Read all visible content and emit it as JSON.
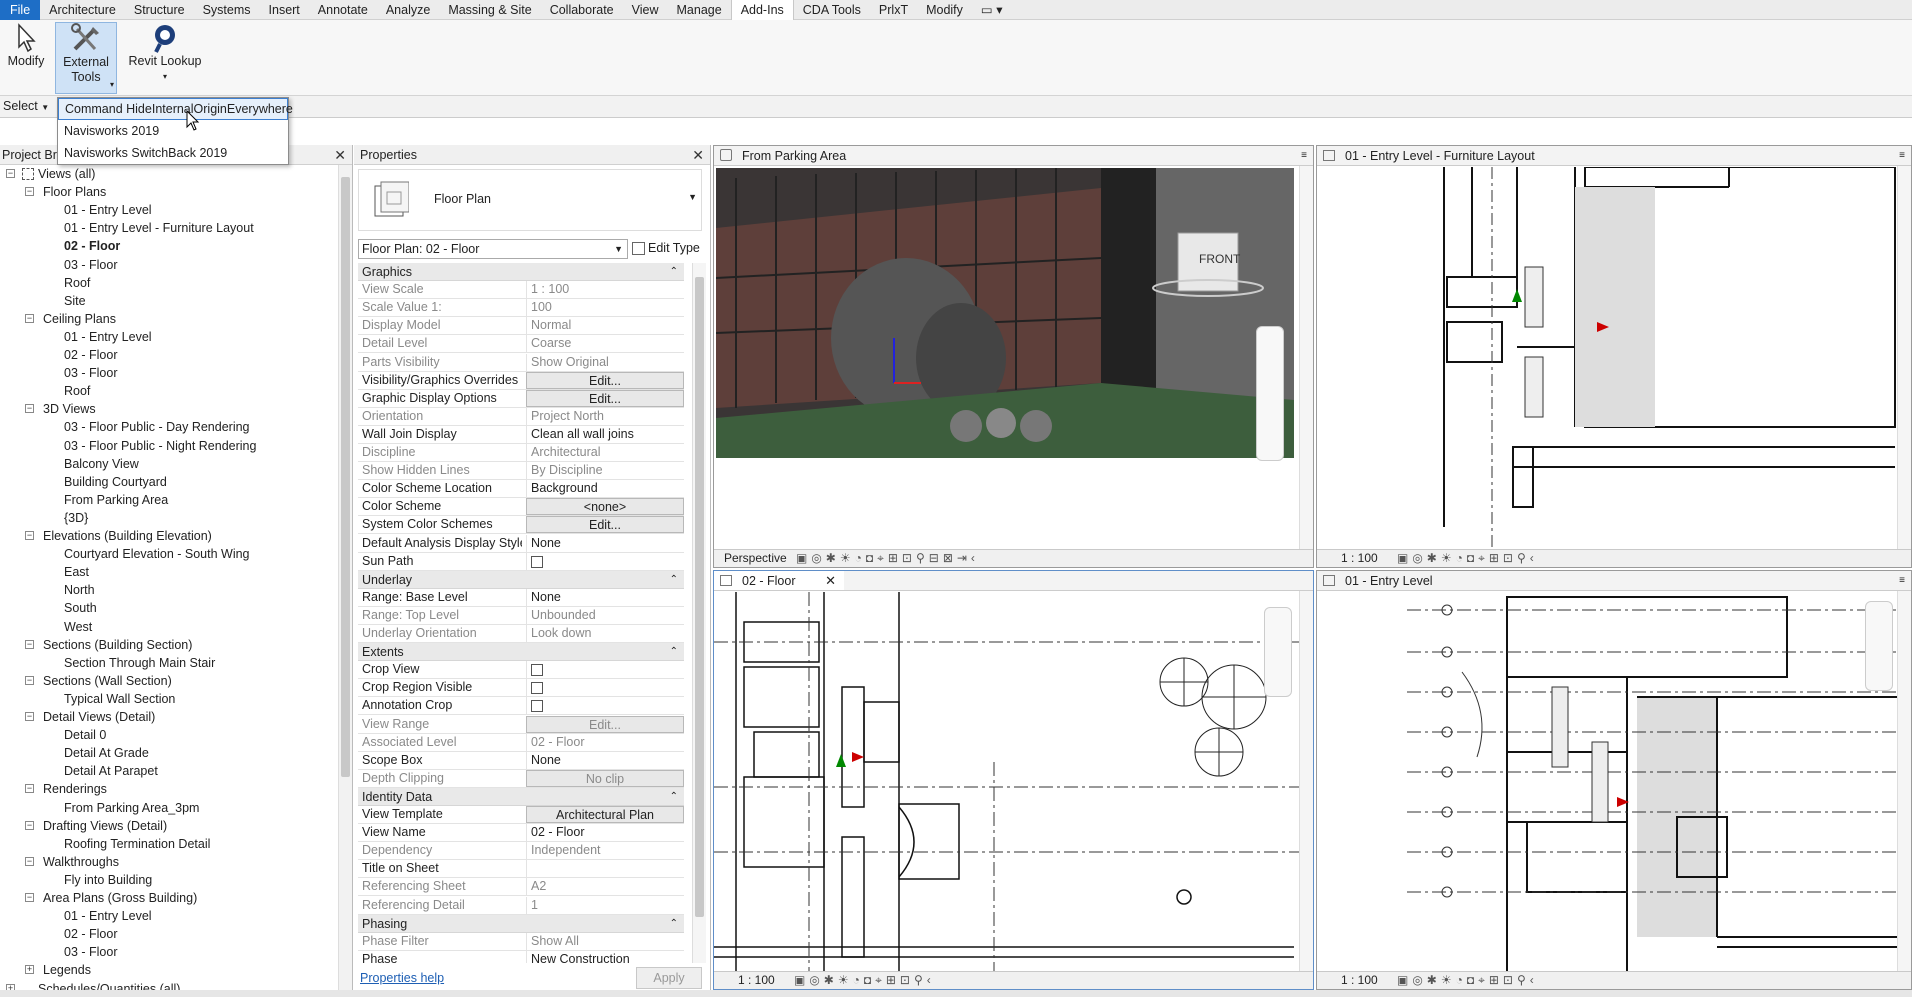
{
  "menu": {
    "items": [
      "File",
      "Architecture",
      "Structure",
      "Systems",
      "Insert",
      "Annotate",
      "Analyze",
      "Massing & Site",
      "Collaborate",
      "View",
      "Manage",
      "Add-Ins",
      "CDA Tools",
      "PrlxT",
      "Modify"
    ],
    "active": "Add-Ins"
  },
  "ribbon": {
    "modify_label": "Modify",
    "external_tools_label_1": "External",
    "external_tools_label_2": "Tools",
    "revit_lookup_label": "Revit Lookup",
    "select_label": "Select"
  },
  "dropdown": {
    "items": [
      "Command HideInternalOriginEverywhere",
      "Navisworks 2019",
      "Navisworks SwitchBack 2019"
    ]
  },
  "project_browser": {
    "title": "Project Bro",
    "tree": [
      {
        "label": "Views (all)",
        "level": 0,
        "toggle": "−"
      },
      {
        "label": "Floor Plans",
        "level": 1,
        "toggle": "−"
      },
      {
        "label": "01 - Entry Level",
        "level": 2
      },
      {
        "label": "01 - Entry Level - Furniture Layout",
        "level": 2
      },
      {
        "label": "02 - Floor",
        "level": 2,
        "bold": true
      },
      {
        "label": "03 - Floor",
        "level": 2
      },
      {
        "label": "Roof",
        "level": 2
      },
      {
        "label": "Site",
        "level": 2
      },
      {
        "label": "Ceiling Plans",
        "level": 1,
        "toggle": "−"
      },
      {
        "label": "01 - Entry Level",
        "level": 2
      },
      {
        "label": "02 - Floor",
        "level": 2
      },
      {
        "label": "03 - Floor",
        "level": 2
      },
      {
        "label": "Roof",
        "level": 2
      },
      {
        "label": "3D Views",
        "level": 1,
        "toggle": "−"
      },
      {
        "label": "03 - Floor Public - Day Rendering",
        "level": 2
      },
      {
        "label": "03 - Floor Public - Night Rendering",
        "level": 2
      },
      {
        "label": "Balcony View",
        "level": 2
      },
      {
        "label": "Building Courtyard",
        "level": 2
      },
      {
        "label": "From Parking Area",
        "level": 2
      },
      {
        "label": "{3D}",
        "level": 2
      },
      {
        "label": "Elevations (Building Elevation)",
        "level": 1,
        "toggle": "−"
      },
      {
        "label": "Courtyard Elevation - South Wing",
        "level": 2
      },
      {
        "label": "East",
        "level": 2
      },
      {
        "label": "North",
        "level": 2
      },
      {
        "label": "South",
        "level": 2
      },
      {
        "label": "West",
        "level": 2
      },
      {
        "label": "Sections (Building Section)",
        "level": 1,
        "toggle": "−"
      },
      {
        "label": "Section Through Main Stair",
        "level": 2
      },
      {
        "label": "Sections (Wall Section)",
        "level": 1,
        "toggle": "−"
      },
      {
        "label": "Typical Wall Section",
        "level": 2
      },
      {
        "label": "Detail Views (Detail)",
        "level": 1,
        "toggle": "−"
      },
      {
        "label": "Detail 0",
        "level": 2
      },
      {
        "label": "Detail At Grade",
        "level": 2
      },
      {
        "label": "Detail At Parapet",
        "level": 2
      },
      {
        "label": "Renderings",
        "level": 1,
        "toggle": "−"
      },
      {
        "label": "From Parking Area_3pm",
        "level": 2
      },
      {
        "label": "Drafting Views (Detail)",
        "level": 1,
        "toggle": "−"
      },
      {
        "label": "Roofing Termination Detail",
        "level": 2
      },
      {
        "label": "Walkthroughs",
        "level": 1,
        "toggle": "−"
      },
      {
        "label": "Fly into Building",
        "level": 2
      },
      {
        "label": "Area Plans (Gross Building)",
        "level": 1,
        "toggle": "−"
      },
      {
        "label": "01 - Entry Level",
        "level": 2
      },
      {
        "label": "02 - Floor",
        "level": 2
      },
      {
        "label": "03 - Floor",
        "level": 2
      },
      {
        "label": "Legends",
        "level": 1,
        "toggle": "+"
      },
      {
        "label": "Schedules/Quantities (all)",
        "level": 0,
        "toggle": "+"
      }
    ]
  },
  "properties": {
    "title": "Properties",
    "type_name": "Floor Plan",
    "selector": "Floor Plan: 02 - Floor",
    "edit_type": "Edit Type",
    "help": "Properties help",
    "apply": "Apply",
    "sections": [
      {
        "header": "Graphics",
        "rows": [
          {
            "k": "View Scale",
            "v": "1 : 100",
            "dim": true
          },
          {
            "k": "Scale Value    1:",
            "v": "100",
            "dim": true
          },
          {
            "k": "Display Model",
            "v": "Normal",
            "dim": true
          },
          {
            "k": "Detail Level",
            "v": "Coarse",
            "dim": true
          },
          {
            "k": "Parts Visibility",
            "v": "Show Original",
            "dim": true
          },
          {
            "k": "Visibility/Graphics Overrides",
            "v": "Edit...",
            "btn": true
          },
          {
            "k": "Graphic Display Options",
            "v": "Edit...",
            "btn": true
          },
          {
            "k": "Orientation",
            "v": "Project North",
            "dim": true
          },
          {
            "k": "Wall Join Display",
            "v": "Clean all wall joins"
          },
          {
            "k": "Discipline",
            "v": "Architectural",
            "dim": true
          },
          {
            "k": "Show Hidden Lines",
            "v": "By Discipline",
            "dim": true
          },
          {
            "k": "Color Scheme Location",
            "v": "Background"
          },
          {
            "k": "Color Scheme",
            "v": "<none>",
            "btn": true
          },
          {
            "k": "System Color Schemes",
            "v": "Edit...",
            "btn": true
          },
          {
            "k": "Default Analysis Display Style",
            "v": "None"
          },
          {
            "k": "Sun Path",
            "v": "",
            "check": true
          }
        ]
      },
      {
        "header": "Underlay",
        "rows": [
          {
            "k": "Range: Base Level",
            "v": "None"
          },
          {
            "k": "Range: Top Level",
            "v": "Unbounded",
            "dim": true
          },
          {
            "k": "Underlay Orientation",
            "v": "Look down",
            "dim": true
          }
        ]
      },
      {
        "header": "Extents",
        "rows": [
          {
            "k": "Crop View",
            "v": "",
            "check": true
          },
          {
            "k": "Crop Region Visible",
            "v": "",
            "check": true
          },
          {
            "k": "Annotation Crop",
            "v": "",
            "check": true
          },
          {
            "k": "View Range",
            "v": "Edit...",
            "btn": true,
            "dim": true
          },
          {
            "k": "Associated Level",
            "v": "02 - Floor",
            "dim": true
          },
          {
            "k": "Scope Box",
            "v": "None"
          },
          {
            "k": "Depth Clipping",
            "v": "No clip",
            "btn": true,
            "dim": true
          }
        ]
      },
      {
        "header": "Identity Data",
        "rows": [
          {
            "k": "View Template",
            "v": "Architectural Plan",
            "btn": true
          },
          {
            "k": "View Name",
            "v": "02 - Floor"
          },
          {
            "k": "Dependency",
            "v": "Independent",
            "dim": true
          },
          {
            "k": "Title on Sheet",
            "v": ""
          },
          {
            "k": "Referencing Sheet",
            "v": "A2",
            "dim": true
          },
          {
            "k": "Referencing Detail",
            "v": "1",
            "dim": true
          }
        ]
      },
      {
        "header": "Phasing",
        "rows": [
          {
            "k": "Phase Filter",
            "v": "Show All",
            "dim": true
          },
          {
            "k": "Phase",
            "v": "New Construction"
          }
        ]
      }
    ]
  },
  "views": {
    "parking": {
      "title": "From Parking Area",
      "mode": "Perspective",
      "cube_label": "FRONT"
    },
    "furniture": {
      "title": "01 - Entry Level - Furniture Layout",
      "scale": "1 : 100"
    },
    "floor2": {
      "title": "02 - Floor",
      "scale": "1 : 100"
    },
    "entry": {
      "title": "01 - Entry Level",
      "scale": "1 : 100"
    }
  },
  "colors": {
    "accent": "#1e6ec6",
    "ribbon_sel": "#cfe2f6"
  }
}
